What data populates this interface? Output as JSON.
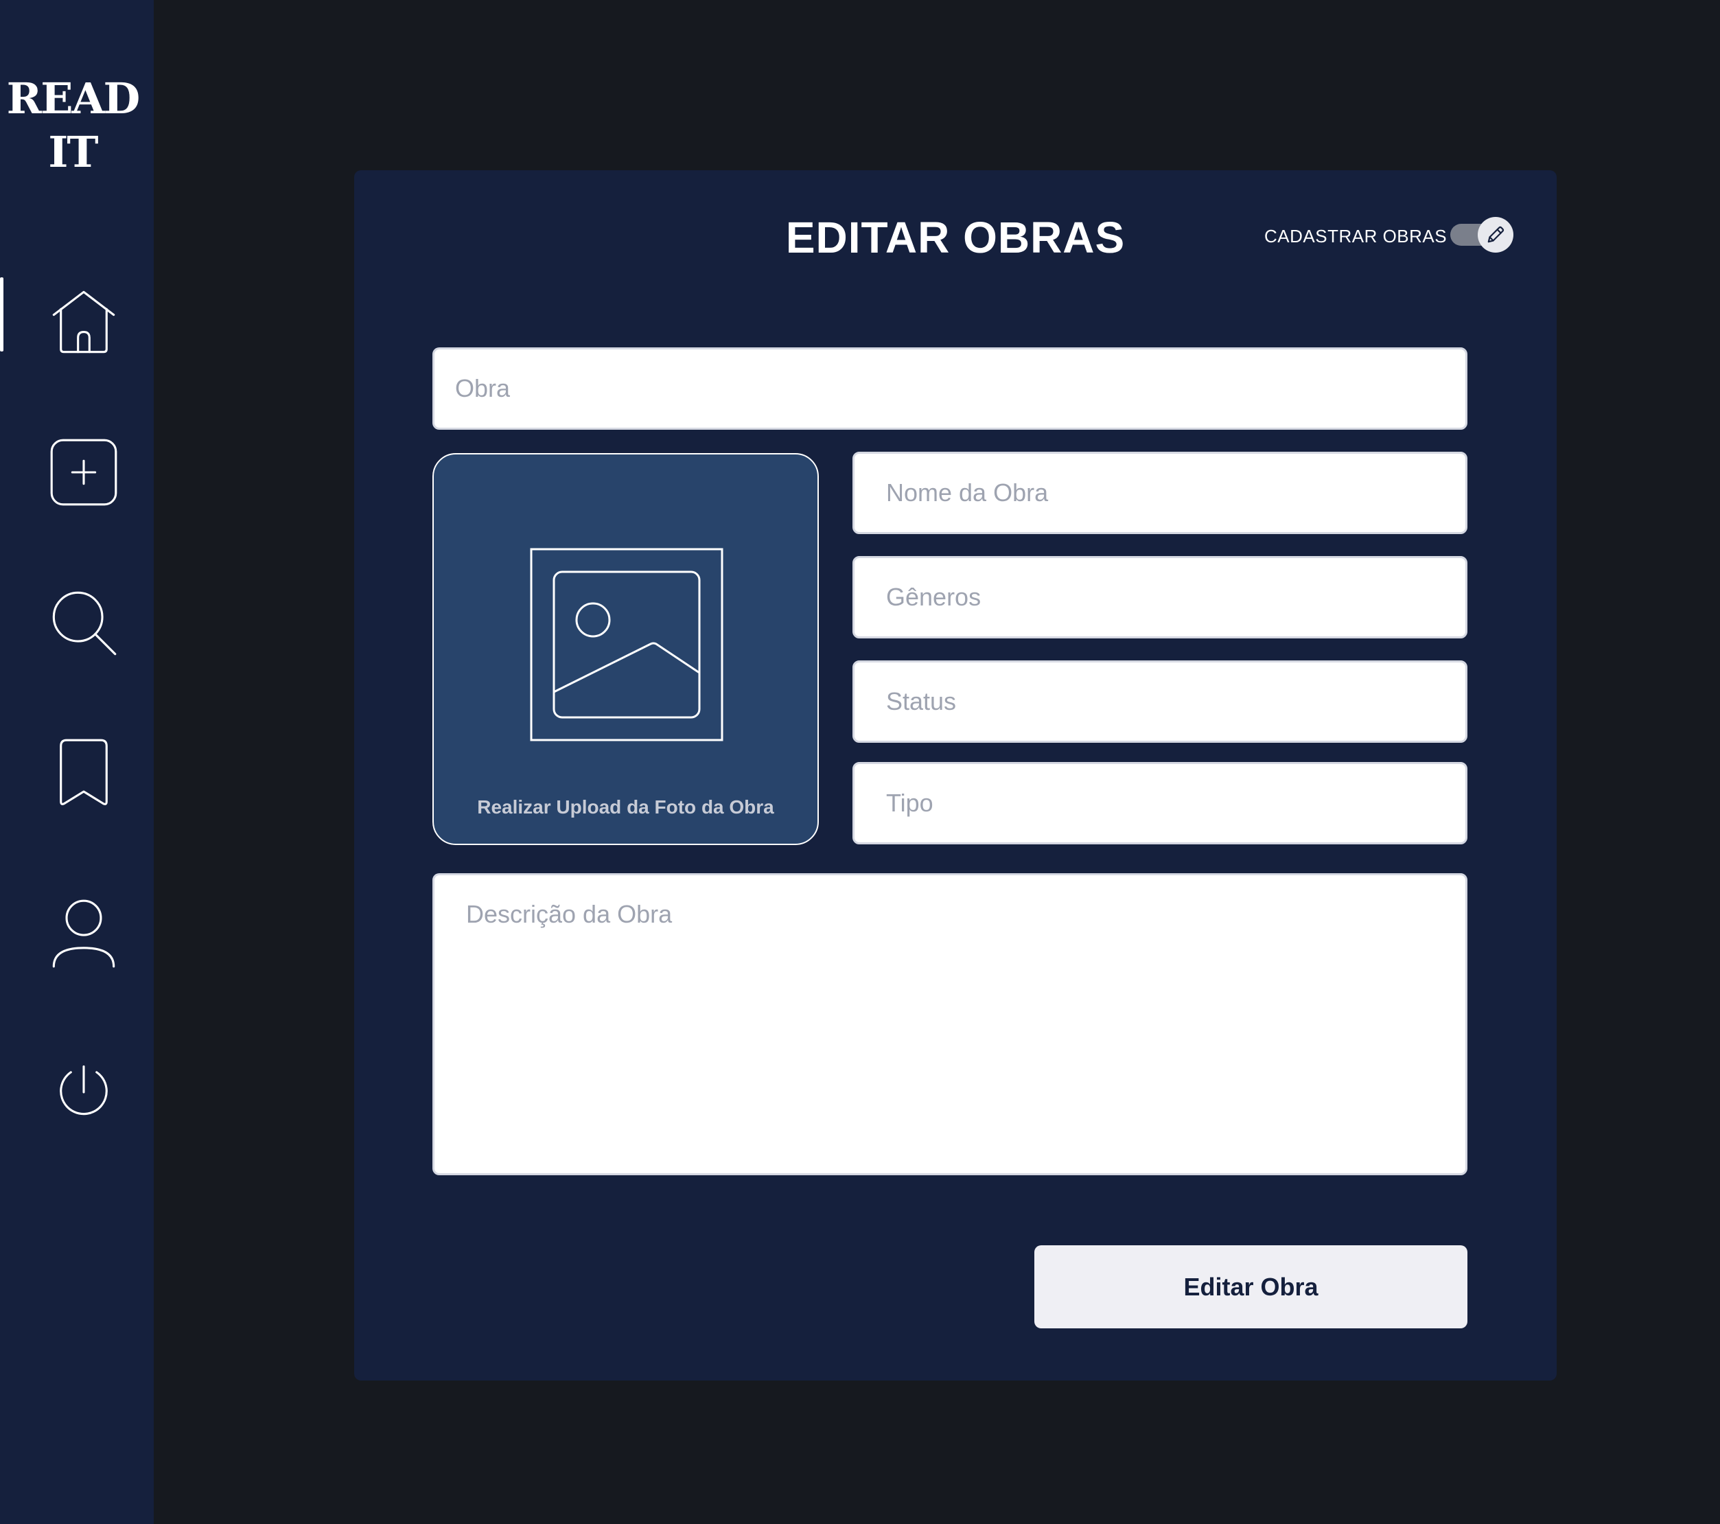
{
  "app": {
    "logo_line1": "READ",
    "logo_line2": "IT"
  },
  "sidebar": {
    "items": [
      {
        "name": "home",
        "icon": "home-icon",
        "active": true
      },
      {
        "name": "add",
        "icon": "plus-square-icon",
        "active": false
      },
      {
        "name": "search",
        "icon": "search-icon",
        "active": false
      },
      {
        "name": "bookmarks",
        "icon": "bookmark-icon",
        "active": false
      },
      {
        "name": "profile",
        "icon": "user-icon",
        "active": false
      },
      {
        "name": "logout",
        "icon": "power-icon",
        "active": false
      }
    ]
  },
  "form": {
    "title": "EDITAR OBRAS",
    "toggle_label": "CADASTRAR OBRAS",
    "toggle_icon": "pencil-icon",
    "fields": {
      "obra_placeholder": "Obra",
      "nome_placeholder": "Nome da Obra",
      "generos_placeholder": "Gêneros",
      "status_placeholder": "Status",
      "tipo_placeholder": "Tipo",
      "descricao_placeholder": "Descrição da Obra"
    },
    "upload_label": "Realizar Upload da Foto da Obra",
    "upload_icon": "image-icon",
    "submit_label": "Editar Obra"
  },
  "colors": {
    "background": "#16191f",
    "panel": "#15203d",
    "upload_box": "#28446b",
    "input_bg": "#ffffff",
    "placeholder": "#9ea3b0",
    "button_bg": "#efeff4"
  }
}
